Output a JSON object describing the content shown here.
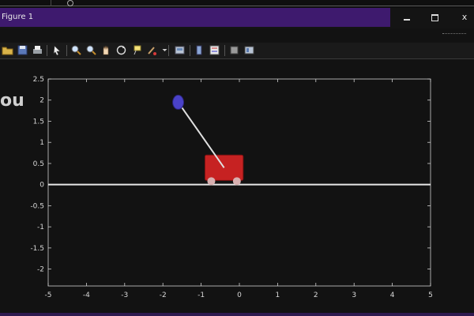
{
  "window": {
    "title": "Figure 1",
    "controls": {
      "minimize": "–",
      "maximize": "□",
      "close": "x"
    },
    "accent_color": "#3e1a6e"
  },
  "toolbar": {
    "icons": [
      "open-folder-icon",
      "save-icon",
      "print-icon",
      "arrow-pointer-icon",
      "zoom-in-icon",
      "zoom-out-icon",
      "pan-hand-icon",
      "rotate-icon",
      "datatip-icon",
      "brush-icon",
      "print-preview-icon",
      "colorbar-icon",
      "legend-icon",
      "hide-plot-tools-icon",
      "show-plot-tools-icon"
    ]
  },
  "left_fragment": "ou",
  "plot": {
    "x_ticks": [
      "-5",
      "-4",
      "-3",
      "-2",
      "-1",
      "0",
      "1",
      "2",
      "3",
      "4",
      "5"
    ],
    "y_ticks": [
      "2.5",
      "2",
      "1.5",
      "1",
      "0.5",
      "0",
      "-0.5",
      "-1",
      "-1.5",
      "-2"
    ],
    "xlim": [
      -5,
      5
    ],
    "ylim": [
      -2.4,
      2.5
    ],
    "ground_y": 0,
    "cart": {
      "center_x": -0.4,
      "bottom_y": 0.1,
      "top_y": 0.7,
      "width": 1.0,
      "color": "#c62222",
      "wheel_color": "#d8b0b0"
    },
    "pendulum": {
      "pivot_x": -0.4,
      "pivot_y": 0.4,
      "bob_x": -1.6,
      "bob_y": 1.95,
      "bob_color": "#4a42c8",
      "rod_color": "#e0e0e0"
    },
    "axis_color": "#cfcfcf",
    "background": "#121212"
  }
}
